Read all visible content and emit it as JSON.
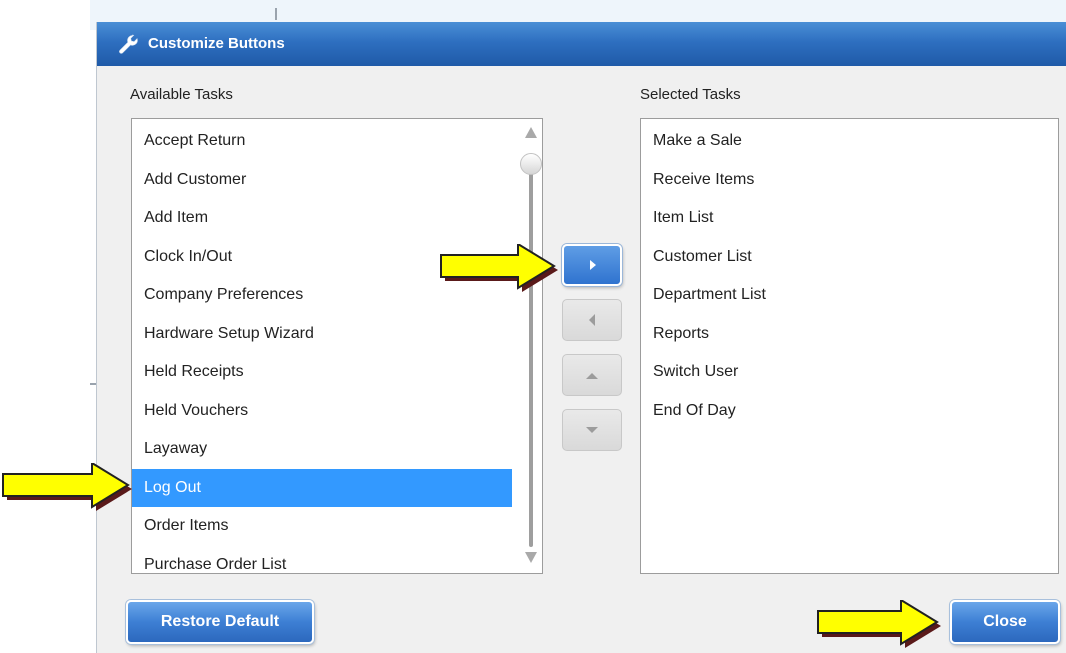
{
  "dialog": {
    "title": "Customize Buttons",
    "title_icon": "wrench-icon"
  },
  "available": {
    "label": "Available Tasks",
    "items": [
      {
        "label": "Accept Return"
      },
      {
        "label": "Add Customer"
      },
      {
        "label": "Add Item"
      },
      {
        "label": "Clock In/Out"
      },
      {
        "label": "Company Preferences"
      },
      {
        "label": "Hardware Setup Wizard"
      },
      {
        "label": "Held Receipts"
      },
      {
        "label": "Held Vouchers"
      },
      {
        "label": "Layaway"
      },
      {
        "label": "Log Out",
        "selected": true
      },
      {
        "label": "Order Items"
      },
      {
        "label": "Purchase Order List"
      }
    ]
  },
  "selected": {
    "label": "Selected Tasks",
    "items": [
      {
        "label": "Make a Sale"
      },
      {
        "label": "Receive Items"
      },
      {
        "label": "Item List"
      },
      {
        "label": "Customer List"
      },
      {
        "label": "Department List"
      },
      {
        "label": "Reports"
      },
      {
        "label": "Switch User"
      },
      {
        "label": "End Of Day"
      }
    ]
  },
  "move_buttons": [
    {
      "name": "add-right-button",
      "icon": "arrow-right-icon",
      "enabled": true
    },
    {
      "name": "remove-left-button",
      "icon": "arrow-left-icon",
      "enabled": false
    },
    {
      "name": "move-up-button",
      "icon": "arrow-up-icon",
      "enabled": false
    },
    {
      "name": "move-down-button",
      "icon": "arrow-down-icon",
      "enabled": false
    }
  ],
  "footer": {
    "restore_label": "Restore Default",
    "close_label": "Close"
  },
  "colors": {
    "titlebar": "#2e6fc0",
    "selection": "#3399ff",
    "button": "#3d7fd4",
    "callout_arrow": "#ffff00"
  }
}
